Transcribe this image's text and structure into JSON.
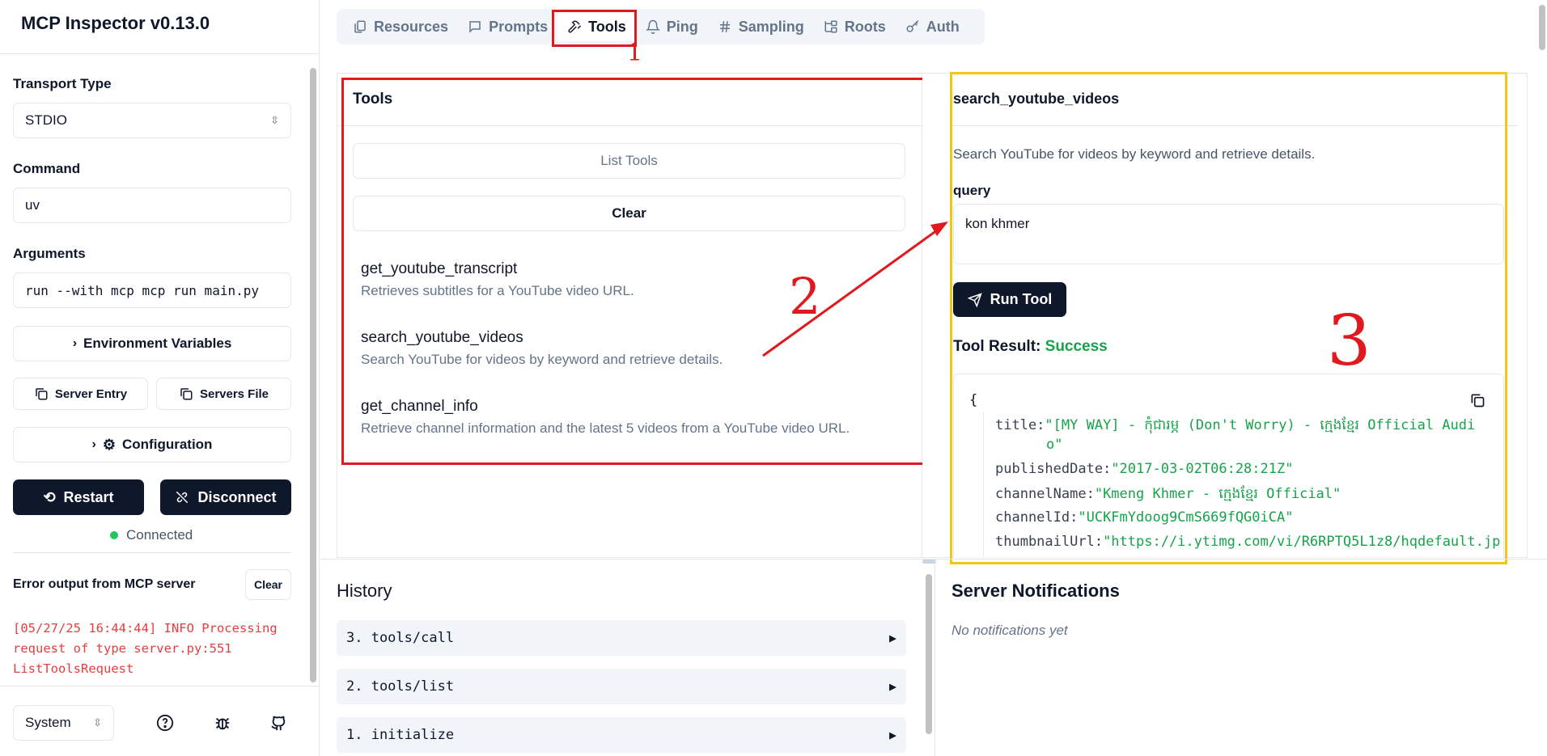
{
  "app": {
    "title": "MCP Inspector v0.13.0"
  },
  "sidebar": {
    "transport_label": "Transport Type",
    "transport_value": "STDIO",
    "command_label": "Command",
    "command_value": "uv",
    "arguments_label": "Arguments",
    "arguments_value": "run --with mcp mcp run main.py",
    "env_button": "Environment Variables",
    "server_entry_button": "Server Entry",
    "servers_file_button": "Servers File",
    "config_button": "Configuration",
    "restart_button": "Restart",
    "disconnect_button": "Disconnect",
    "status": "Connected",
    "error_title": "Error output from MCP server",
    "error_clear": "Clear",
    "error_lines": [
      "[05/27/25 16:44:44] INFO Processing",
      "request of type server.py:551",
      "ListToolsRequest"
    ],
    "theme_value": "System"
  },
  "tabs": [
    {
      "label": "Resources",
      "icon": "files-icon"
    },
    {
      "label": "Prompts",
      "icon": "message-icon"
    },
    {
      "label": "Tools",
      "icon": "hammer-icon"
    },
    {
      "label": "Ping",
      "icon": "bell-icon"
    },
    {
      "label": "Sampling",
      "icon": "hash-icon"
    },
    {
      "label": "Roots",
      "icon": "folder-tree-icon"
    },
    {
      "label": "Auth",
      "icon": "key-icon"
    }
  ],
  "tools_panel": {
    "title": "Tools",
    "list_button": "List Tools",
    "clear_button": "Clear",
    "items": [
      {
        "name": "get_youtube_transcript",
        "desc": "Retrieves subtitles for a YouTube video URL."
      },
      {
        "name": "search_youtube_videos",
        "desc": "Search YouTube for videos by keyword and retrieve details."
      },
      {
        "name": "get_channel_info",
        "desc": "Retrieve channel information and the latest 5 videos from a YouTube video URL."
      }
    ]
  },
  "detail": {
    "title": "search_youtube_videos",
    "desc": "Search YouTube for videos by keyword and retrieve details.",
    "param_label": "query",
    "param_value": "kon khmer",
    "run_button": "Run Tool",
    "result_label": "Tool Result:",
    "result_status": "Success",
    "json": {
      "open": "{",
      "title_key": "title:",
      "title_val1": "\"[MY WAY] - កុំជារម្ភ (Don't Worry) - ក្មេងខ្មែរ Official Audi",
      "title_val2": "o\"",
      "date_key": "publishedDate:",
      "date_val": "\"2017-03-02T06:28:21Z\"",
      "chan_key": "channelName:",
      "chan_val": "\"Kmeng Khmer - ក្មេងខ្មែរ Official\"",
      "id_key": "channelId:",
      "id_val": "\"UCKFmYdoog9CmS669fQG0iCA\"",
      "thumb_key": "thumbnailUrl:",
      "thumb_val": "\"https://i.ytimg.com/vi/R6RPTQ5L1z8/hqdefault.jp"
    }
  },
  "history": {
    "title": "History",
    "rows": [
      "3. tools/call",
      "2. tools/list",
      "1. initialize"
    ]
  },
  "notifications": {
    "title": "Server Notifications",
    "empty": "No notifications yet"
  },
  "annotations": {
    "n1": "1",
    "n2": "2",
    "n3": "3"
  },
  "colors": {
    "red": "#e0191f",
    "yellow": "#f5c518",
    "success": "#16a34a"
  }
}
